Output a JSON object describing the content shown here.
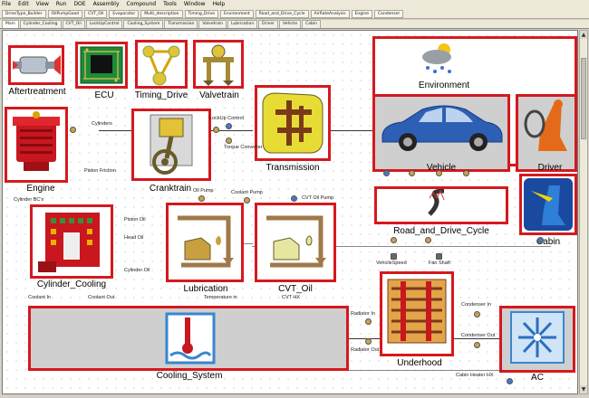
{
  "menu": [
    "File",
    "Edit",
    "View",
    "Run",
    "DOE",
    "Assembly",
    "Compound",
    "Tools",
    "Window",
    "Help"
  ],
  "toolbar_tabs": [
    "DriveType_Builder",
    "OilPumpGood",
    "CVT_Oil",
    "Evaporator",
    "Multi_description",
    "Timing_Drive",
    "Environment",
    "Road_and_Drive_Cycle",
    "AirRateAnalysis",
    "Engine",
    "Condenser"
  ],
  "document_tabs": [
    "Main",
    "Cylinder_Cooling",
    "CVT_Oil",
    "LockUpControl",
    "Cooling_System",
    "Transmission",
    "Valvetrain",
    "Lubrication",
    "Driver",
    "Vehicle",
    "Cabin"
  ],
  "components": {
    "aftertreatment": "Aftertreatment",
    "ecu": "ECU",
    "timing_drive": "Timing_Drive",
    "valvetrain": "Valvetrain",
    "environment": "Environment",
    "engine": "Engine",
    "cranktrain": "Cranktrain",
    "transmission": "Transmission",
    "vehicle": "Vehicle",
    "driver": "Driver",
    "road_and_drive_cycle": "Road_and_Drive_Cycle",
    "cabin": "Cabin",
    "cylinder_cooling": "Cylinder_Cooling",
    "lubrication": "Lubrication",
    "cvt_oil": "CVT_Oil",
    "underhood": "Underhood",
    "cooling_system": "Cooling_System",
    "ac": "AC"
  },
  "signals": {
    "cylinders": "Cylinders",
    "lockup_control": "LockUp Control",
    "torque_converter": "Torque Converter",
    "piston_friction": "Piston Friction",
    "cylinder_bcs": "Cylinder BC's",
    "coolant_pump": "Coolant Pump",
    "oil_pump": "Oil Pump",
    "cvt_oil_pump": "CVT Oil Pump",
    "piston_oil": "Piston Oil",
    "head_oil": "Head Oil",
    "cylinder_oil": "Cylinder Oil",
    "coolant_in": "Coolant In",
    "coolant_out": "Coolant Out",
    "temperature_in": "Temperature in",
    "cvt_hx": "CVT HX",
    "vehicle_speed": "VehicleSpeed",
    "fan_shaft": "Fan Shaft",
    "radiator_in": "Radiator In",
    "radiator_out": "Radiator Out",
    "condenser_in": "Condenser In",
    "condenser_out": "Condenser Out",
    "cabin_heater_hx": "Cabin Heater HX"
  },
  "colors": {
    "highlight_border": "#d4191f",
    "engine_red": "#c8171f",
    "oil_gold": "#c8a040",
    "vehicle_blue": "#2d5fb5",
    "cooling_blue": "#3a86d0"
  }
}
